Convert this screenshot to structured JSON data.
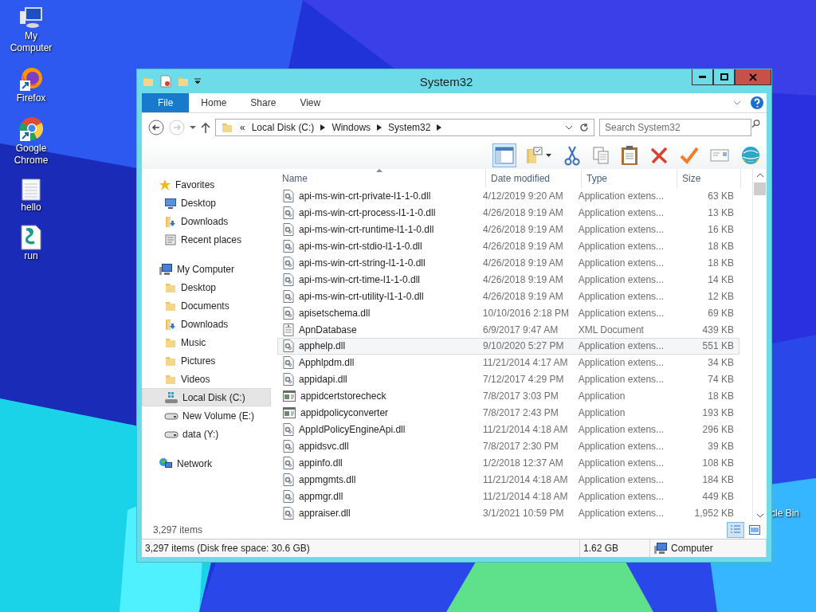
{
  "desktop": {
    "icons": [
      {
        "label": "My Computer",
        "kind": "computer"
      },
      {
        "label": "Firefox",
        "kind": "firefox"
      },
      {
        "label": "Google Chrome",
        "kind": "chrome"
      },
      {
        "label": "hello",
        "kind": "text"
      },
      {
        "label": "run",
        "kind": "script"
      }
    ],
    "partial_icon": {
      "label": "cle Bin"
    }
  },
  "window": {
    "title": "System32"
  },
  "ribbon": {
    "tabs": [
      {
        "label": "File",
        "kind": "file"
      },
      {
        "label": "Home",
        "kind": "tab"
      },
      {
        "label": "Share",
        "kind": "tab"
      },
      {
        "label": "View",
        "kind": "tab"
      }
    ]
  },
  "address": {
    "overflow": "«",
    "path": [
      "Local Disk (C:)",
      "Windows",
      "System32"
    ]
  },
  "search": {
    "placeholder": "Search System32"
  },
  "navigation": [
    {
      "label": "Favorites",
      "kind": "star",
      "selected": false,
      "children": [
        {
          "label": "Desktop",
          "kind": "desktop",
          "selected": false
        },
        {
          "label": "Downloads",
          "kind": "downloads",
          "selected": false
        },
        {
          "label": "Recent places",
          "kind": "recent",
          "selected": false
        }
      ]
    },
    {
      "label": "My Computer",
      "kind": "computer",
      "selected": false,
      "children": [
        {
          "label": "Desktop",
          "kind": "folder",
          "selected": false
        },
        {
          "label": "Documents",
          "kind": "folder",
          "selected": false
        },
        {
          "label": "Downloads",
          "kind": "downloads",
          "selected": false
        },
        {
          "label": "Music",
          "kind": "folder",
          "selected": false
        },
        {
          "label": "Pictures",
          "kind": "folder",
          "selected": false
        },
        {
          "label": "Videos",
          "kind": "folder",
          "selected": false
        },
        {
          "label": "Local Disk (C:)",
          "kind": "system-drive",
          "selected": true
        },
        {
          "label": "New Volume (E:)",
          "kind": "drive",
          "selected": false
        },
        {
          "label": "data (Y:)",
          "kind": "drive",
          "selected": false
        }
      ]
    },
    {
      "label": "Network",
      "kind": "network",
      "selected": false
    }
  ],
  "columns": [
    "Name",
    "Date modified",
    "Type",
    "Size"
  ],
  "files": [
    {
      "name": "api-ms-win-crt-private-l1-1-0.dll",
      "date": "4/12/2019 9:20 AM",
      "type": "Application extens...",
      "size": "63 KB",
      "kind": "dll",
      "selected": false
    },
    {
      "name": "api-ms-win-crt-process-l1-1-0.dll",
      "date": "4/26/2018 9:19 AM",
      "type": "Application extens...",
      "size": "13 KB",
      "kind": "dll",
      "selected": false
    },
    {
      "name": "api-ms-win-crt-runtime-l1-1-0.dll",
      "date": "4/26/2018 9:19 AM",
      "type": "Application extens...",
      "size": "16 KB",
      "kind": "dll",
      "selected": false
    },
    {
      "name": "api-ms-win-crt-stdio-l1-1-0.dll",
      "date": "4/26/2018 9:19 AM",
      "type": "Application extens...",
      "size": "18 KB",
      "kind": "dll",
      "selected": false
    },
    {
      "name": "api-ms-win-crt-string-l1-1-0.dll",
      "date": "4/26/2018 9:19 AM",
      "type": "Application extens...",
      "size": "18 KB",
      "kind": "dll",
      "selected": false
    },
    {
      "name": "api-ms-win-crt-time-l1-1-0.dll",
      "date": "4/26/2018 9:19 AM",
      "type": "Application extens...",
      "size": "14 KB",
      "kind": "dll",
      "selected": false
    },
    {
      "name": "api-ms-win-crt-utility-l1-1-0.dll",
      "date": "4/26/2018 9:19 AM",
      "type": "Application extens...",
      "size": "12 KB",
      "kind": "dll",
      "selected": false
    },
    {
      "name": "apisetschema.dll",
      "date": "10/10/2016 2:18 PM",
      "type": "Application extens...",
      "size": "69 KB",
      "kind": "dll",
      "selected": false
    },
    {
      "name": "ApnDatabase",
      "date": "6/9/2017 9:47 AM",
      "type": "XML Document",
      "size": "439 KB",
      "kind": "xml",
      "selected": false
    },
    {
      "name": "apphelp.dll",
      "date": "9/10/2020 5:27 PM",
      "type": "Application extens...",
      "size": "551 KB",
      "kind": "dll",
      "selected": true
    },
    {
      "name": "Apphlpdm.dll",
      "date": "11/21/2014 4:17 AM",
      "type": "Application extens...",
      "size": "34 KB",
      "kind": "dll",
      "selected": false
    },
    {
      "name": "appidapi.dll",
      "date": "7/12/2017 4:29 PM",
      "type": "Application extens...",
      "size": "74 KB",
      "kind": "dll",
      "selected": false
    },
    {
      "name": "appidcertstorecheck",
      "date": "7/8/2017 3:03 PM",
      "type": "Application",
      "size": "18 KB",
      "kind": "exe",
      "selected": false
    },
    {
      "name": "appidpolicyconverter",
      "date": "7/8/2017 2:43 PM",
      "type": "Application",
      "size": "193 KB",
      "kind": "exe",
      "selected": false
    },
    {
      "name": "AppIdPolicyEngineApi.dll",
      "date": "11/21/2014 4:18 AM",
      "type": "Application extens...",
      "size": "296 KB",
      "kind": "dll",
      "selected": false
    },
    {
      "name": "appidsvc.dll",
      "date": "7/8/2017 2:30 PM",
      "type": "Application extens...",
      "size": "39 KB",
      "kind": "dll",
      "selected": false
    },
    {
      "name": "appinfo.dll",
      "date": "1/2/2018 12:37 AM",
      "type": "Application extens...",
      "size": "108 KB",
      "kind": "dll",
      "selected": false
    },
    {
      "name": "appmgmts.dll",
      "date": "11/21/2014 4:18 AM",
      "type": "Application extens...",
      "size": "184 KB",
      "kind": "dll",
      "selected": false
    },
    {
      "name": "appmgr.dll",
      "date": "11/21/2014 4:18 AM",
      "type": "Application extens...",
      "size": "449 KB",
      "kind": "dll",
      "selected": false
    },
    {
      "name": "appraiser.dll",
      "date": "3/1/2021 10:59 PM",
      "type": "Application extens...",
      "size": "1,952 KB",
      "kind": "dll",
      "selected": false
    }
  ],
  "status": {
    "count": "3,297 items",
    "views": [
      {
        "kind": "details",
        "selected": true
      },
      {
        "kind": "preview",
        "selected": false
      }
    ]
  },
  "status_bar": {
    "summary": "3,297 items (Disk free space: 30.6 GB)",
    "size": "1.62 GB",
    "location": "Computer"
  }
}
